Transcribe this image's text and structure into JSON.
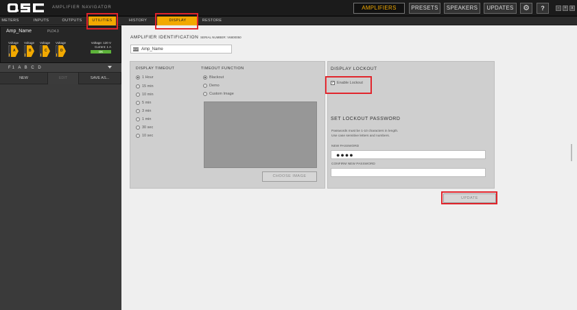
{
  "app": {
    "logo_text": "QSC",
    "title": "AMPLIFIER NAVIGATOR"
  },
  "header": {
    "buttons": [
      "AMPLIFIERS",
      "PRESETS",
      "SPEAKERS",
      "UPDATES"
    ],
    "active": "AMPLIFIERS",
    "settings_icon": "gear-icon",
    "help_label": "?",
    "window_controls": [
      "-",
      "+",
      "x"
    ]
  },
  "left_tabs": {
    "items": [
      "METERS",
      "INPUTS",
      "OUTPUTS",
      "UTILITIES"
    ],
    "active": "UTILITIES"
  },
  "amp_card": {
    "name": "Amp_Name",
    "model": "PLD4.3",
    "channels": [
      {
        "label": "Voltage",
        "letter": "A",
        "level": 0.3
      },
      {
        "label": "Voltage",
        "letter": "B",
        "level": 0.3
      },
      {
        "label": "Voltage",
        "letter": "C",
        "level": 0.3
      },
      {
        "label": "Voltage",
        "letter": "D",
        "level": 0.3
      }
    ],
    "voltage": "Voltage: 120 V",
    "current": "Current: 1 A",
    "status": "OK"
  },
  "preset": {
    "value": "F1 A B C D"
  },
  "left_buttons": {
    "new": "NEW",
    "edit": "EDIT",
    "save_as": "SAVE AS..."
  },
  "sub_tabs": {
    "items": [
      "HISTORY",
      "DISPLAY",
      "RESTORE"
    ],
    "active": "DISPLAY"
  },
  "identification": {
    "heading": "AMPLIFIER IDENTIFICATION",
    "serial": "SERIAL NUMBER: V6800050",
    "edit_icon_text": "EDIT",
    "name_value": "Amp_Name"
  },
  "display_timeout": {
    "heading": "DISPLAY TIMEOUT",
    "options": [
      "1 Hour",
      "15 min",
      "10 min",
      "5 min",
      "3 min",
      "1 min",
      "30 sec",
      "10 sec"
    ],
    "selected": "1 Hour"
  },
  "timeout_function": {
    "heading": "TIMEOUT FUNCTION",
    "options": [
      "Blackout",
      "Demo",
      "Custom Image"
    ],
    "selected": "Blackout",
    "choose_image_label": "CHOOSE IMAGE"
  },
  "display_lockout": {
    "heading": "DISPLAY LOCKOUT",
    "enable_label": "Enable Lockout",
    "enabled": true,
    "password_heading": "SET LOCKOUT PASSWORD",
    "help_line1": "Passwords must be 1-10 characters in length.",
    "help_line2": "Use case sensitive letters and numbers.",
    "new_password_label": "NEW PASSWORD",
    "new_password_value": "●●●●",
    "confirm_label": "CONFIRM NEW PASSWORD",
    "confirm_value": "",
    "update_label": "UPDATE"
  },
  "colors": {
    "accent": "#f2a900",
    "highlight": "#e1232a",
    "ok": "#5db33a"
  }
}
